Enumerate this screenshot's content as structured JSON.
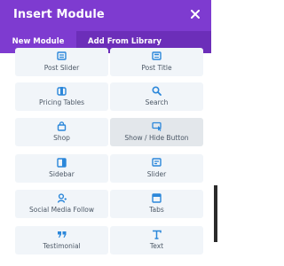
{
  "modal": {
    "title": "Insert Module",
    "close_icon": "close-icon",
    "colors": {
      "header": "#7e3bd0",
      "tabs": "#6c2eb9",
      "accent": "#2b87da"
    }
  },
  "tabs": [
    {
      "label": "New Module",
      "active": true
    },
    {
      "label": "Add From Library",
      "active": false
    }
  ],
  "modules": [
    {
      "label": "Post Slider",
      "icon": "post-slider-icon"
    },
    {
      "label": "Post Title",
      "icon": "post-title-icon"
    },
    {
      "label": "Pricing Tables",
      "icon": "pricing-tables-icon"
    },
    {
      "label": "Search",
      "icon": "search-icon"
    },
    {
      "label": "Shop",
      "icon": "shop-icon"
    },
    {
      "label": "Show / Hide Button",
      "icon": "show-hide-button-icon"
    },
    {
      "label": "Sidebar",
      "icon": "sidebar-icon"
    },
    {
      "label": "Slider",
      "icon": "slider-icon"
    },
    {
      "label": "Social Media Follow",
      "icon": "social-media-follow-icon"
    },
    {
      "label": "Tabs",
      "icon": "tabs-icon"
    },
    {
      "label": "Testimonial",
      "icon": "testimonial-icon"
    },
    {
      "label": "Text",
      "icon": "text-icon"
    }
  ]
}
